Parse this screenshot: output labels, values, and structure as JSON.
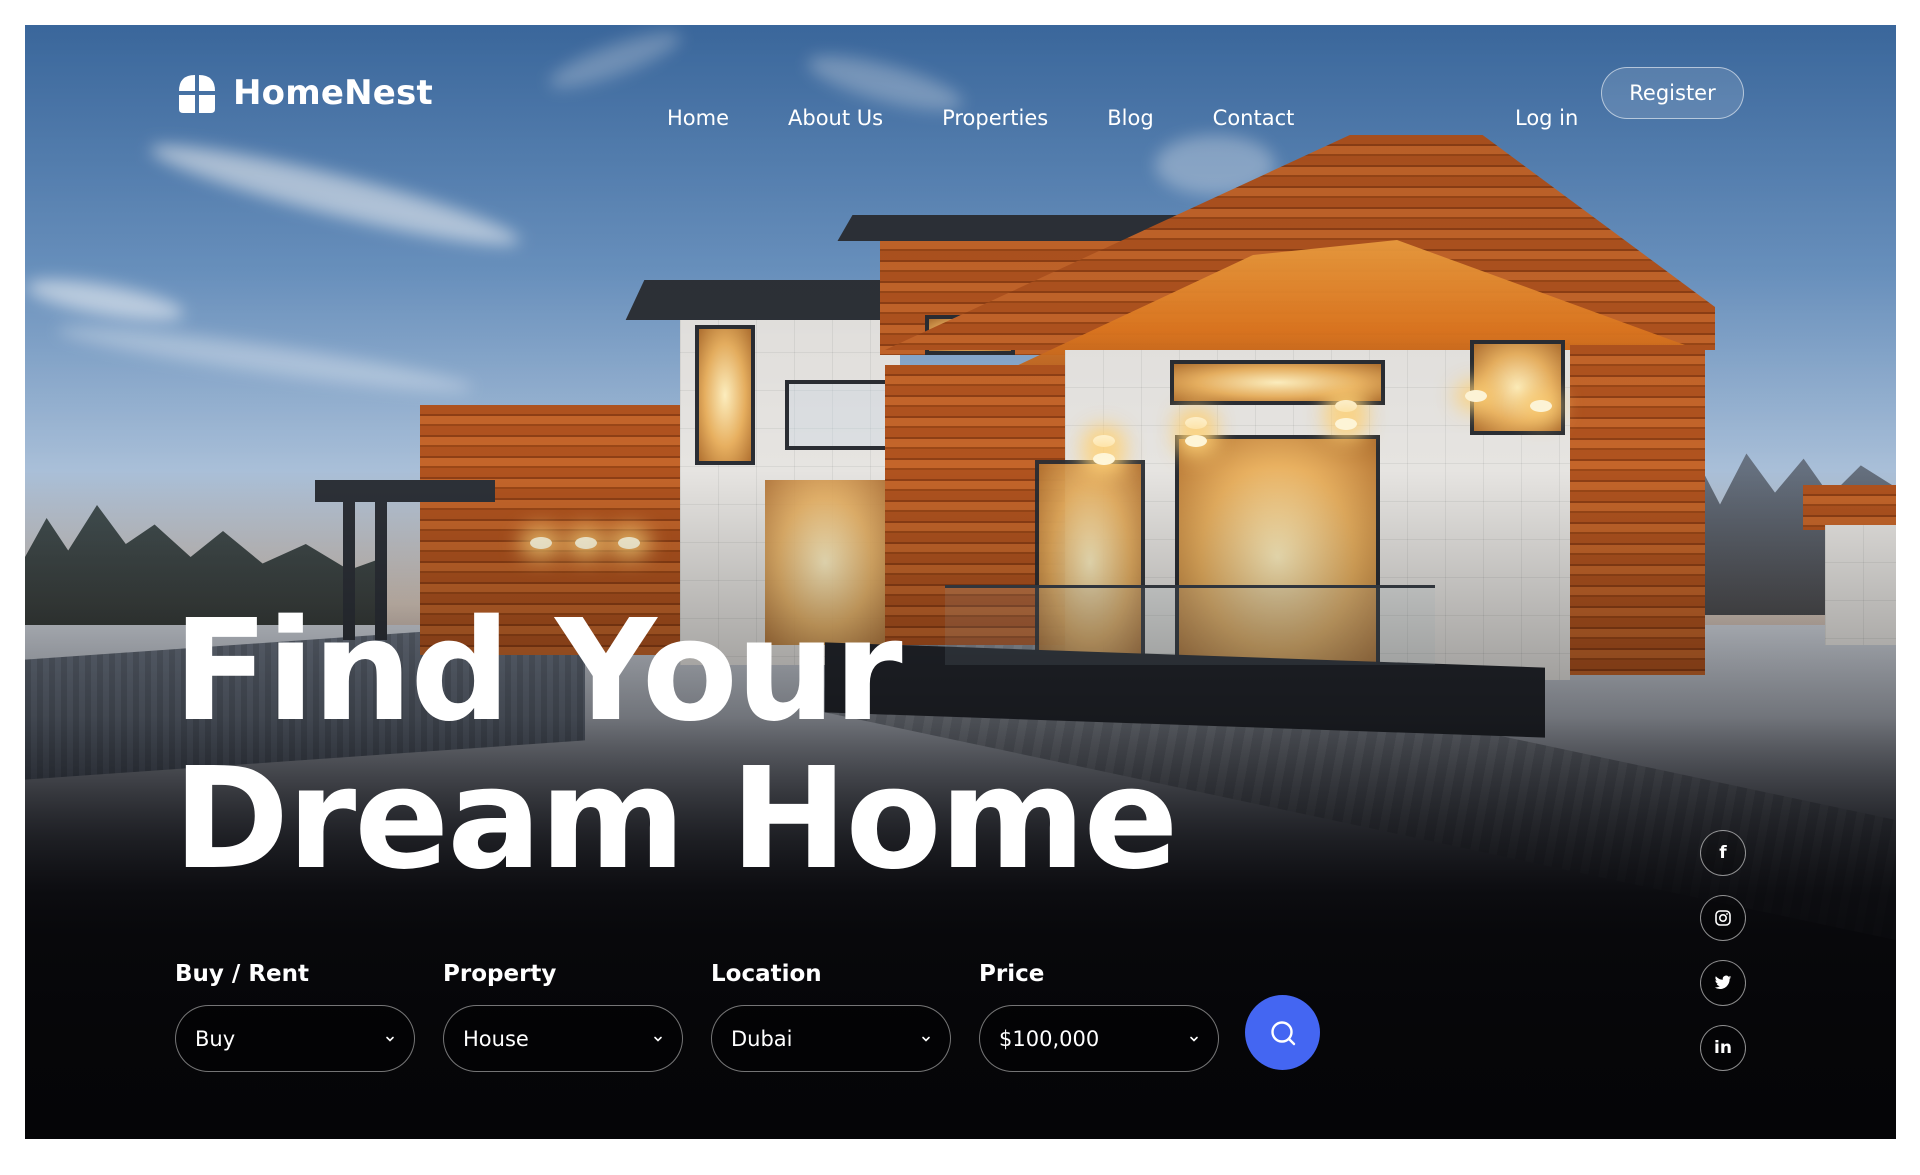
{
  "brand": {
    "name": "HomeNest",
    "logo_icon": "house-quadrant-icon"
  },
  "nav": {
    "items": [
      {
        "label": "Home"
      },
      {
        "label": "About Us"
      },
      {
        "label": "Properties"
      },
      {
        "label": "Blog"
      },
      {
        "label": "Contact"
      }
    ],
    "login_label": "Log in",
    "register_label": "Register"
  },
  "hero": {
    "title_line1": "Find Your",
    "title_line2": "Dream Home",
    "background": "modern-wooden-house-at-dusk-in-snow"
  },
  "search": {
    "fields": [
      {
        "label": "Buy / Rent",
        "value": "Buy"
      },
      {
        "label": "Property",
        "value": "House"
      },
      {
        "label": "Location",
        "value": "Dubai"
      },
      {
        "label": "Price",
        "value": "$100,000"
      }
    ],
    "button_icon": "search-icon"
  },
  "social": {
    "items": [
      {
        "icon": "facebook-icon",
        "glyph": "f"
      },
      {
        "icon": "instagram-icon",
        "glyph": ""
      },
      {
        "icon": "twitter-icon",
        "glyph": ""
      },
      {
        "icon": "linkedin-icon",
        "glyph": "in"
      }
    ]
  },
  "colors": {
    "accent": "#4466f2",
    "text": "#ffffff",
    "background_bottom": "#050507"
  }
}
